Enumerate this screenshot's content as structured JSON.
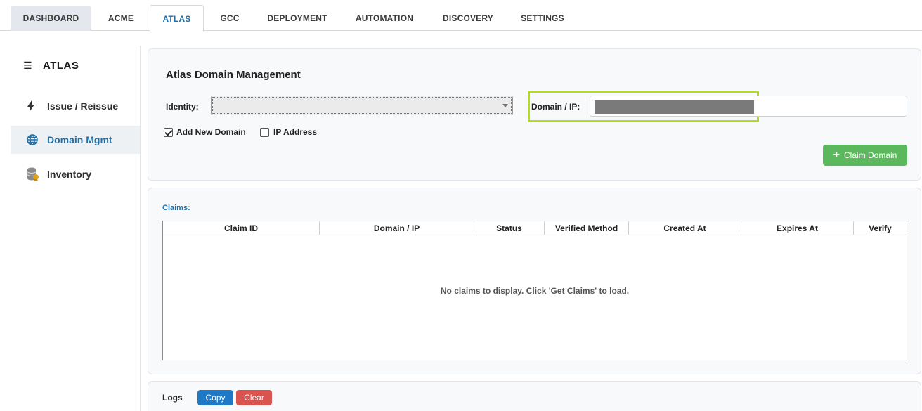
{
  "tabs": [
    {
      "label": "DASHBOARD"
    },
    {
      "label": "ACME"
    },
    {
      "label": "ATLAS",
      "active": true
    },
    {
      "label": "GCC"
    },
    {
      "label": "DEPLOYMENT"
    },
    {
      "label": "AUTOMATION"
    },
    {
      "label": "DISCOVERY"
    },
    {
      "label": "SETTINGS"
    }
  ],
  "sidebar": {
    "title": "ATLAS",
    "items": [
      {
        "label": "Issue / Reissue",
        "icon": "lightning-icon"
      },
      {
        "label": "Domain Mgmt",
        "icon": "globe-icon",
        "active": true
      },
      {
        "label": "Inventory",
        "icon": "database-certificate-icon"
      }
    ]
  },
  "domain_panel": {
    "title": "Atlas Domain Management",
    "identity_label": "Identity:",
    "identity_value": "",
    "domain_label": "Domain / IP:",
    "add_new_domain_label": "Add New Domain",
    "add_new_domain_checked": true,
    "ip_address_label": "IP Address",
    "ip_address_checked": false,
    "claim_button": "Claim Domain"
  },
  "claims": {
    "label": "Claims:",
    "columns": [
      "Claim ID",
      "Domain / IP",
      "Status",
      "Verified Method",
      "Created At",
      "Expires At",
      "Verify"
    ],
    "empty_message": "No claims to display. Click 'Get Claims' to load."
  },
  "logs": {
    "label": "Logs",
    "copy_button": "Copy",
    "clear_button": "Clear"
  },
  "colors": {
    "accent": "#1f6fa8",
    "highlight": "#b4dc1e",
    "success": "#5cb85c",
    "primary": "#1f79c4",
    "danger": "#d9534f"
  }
}
